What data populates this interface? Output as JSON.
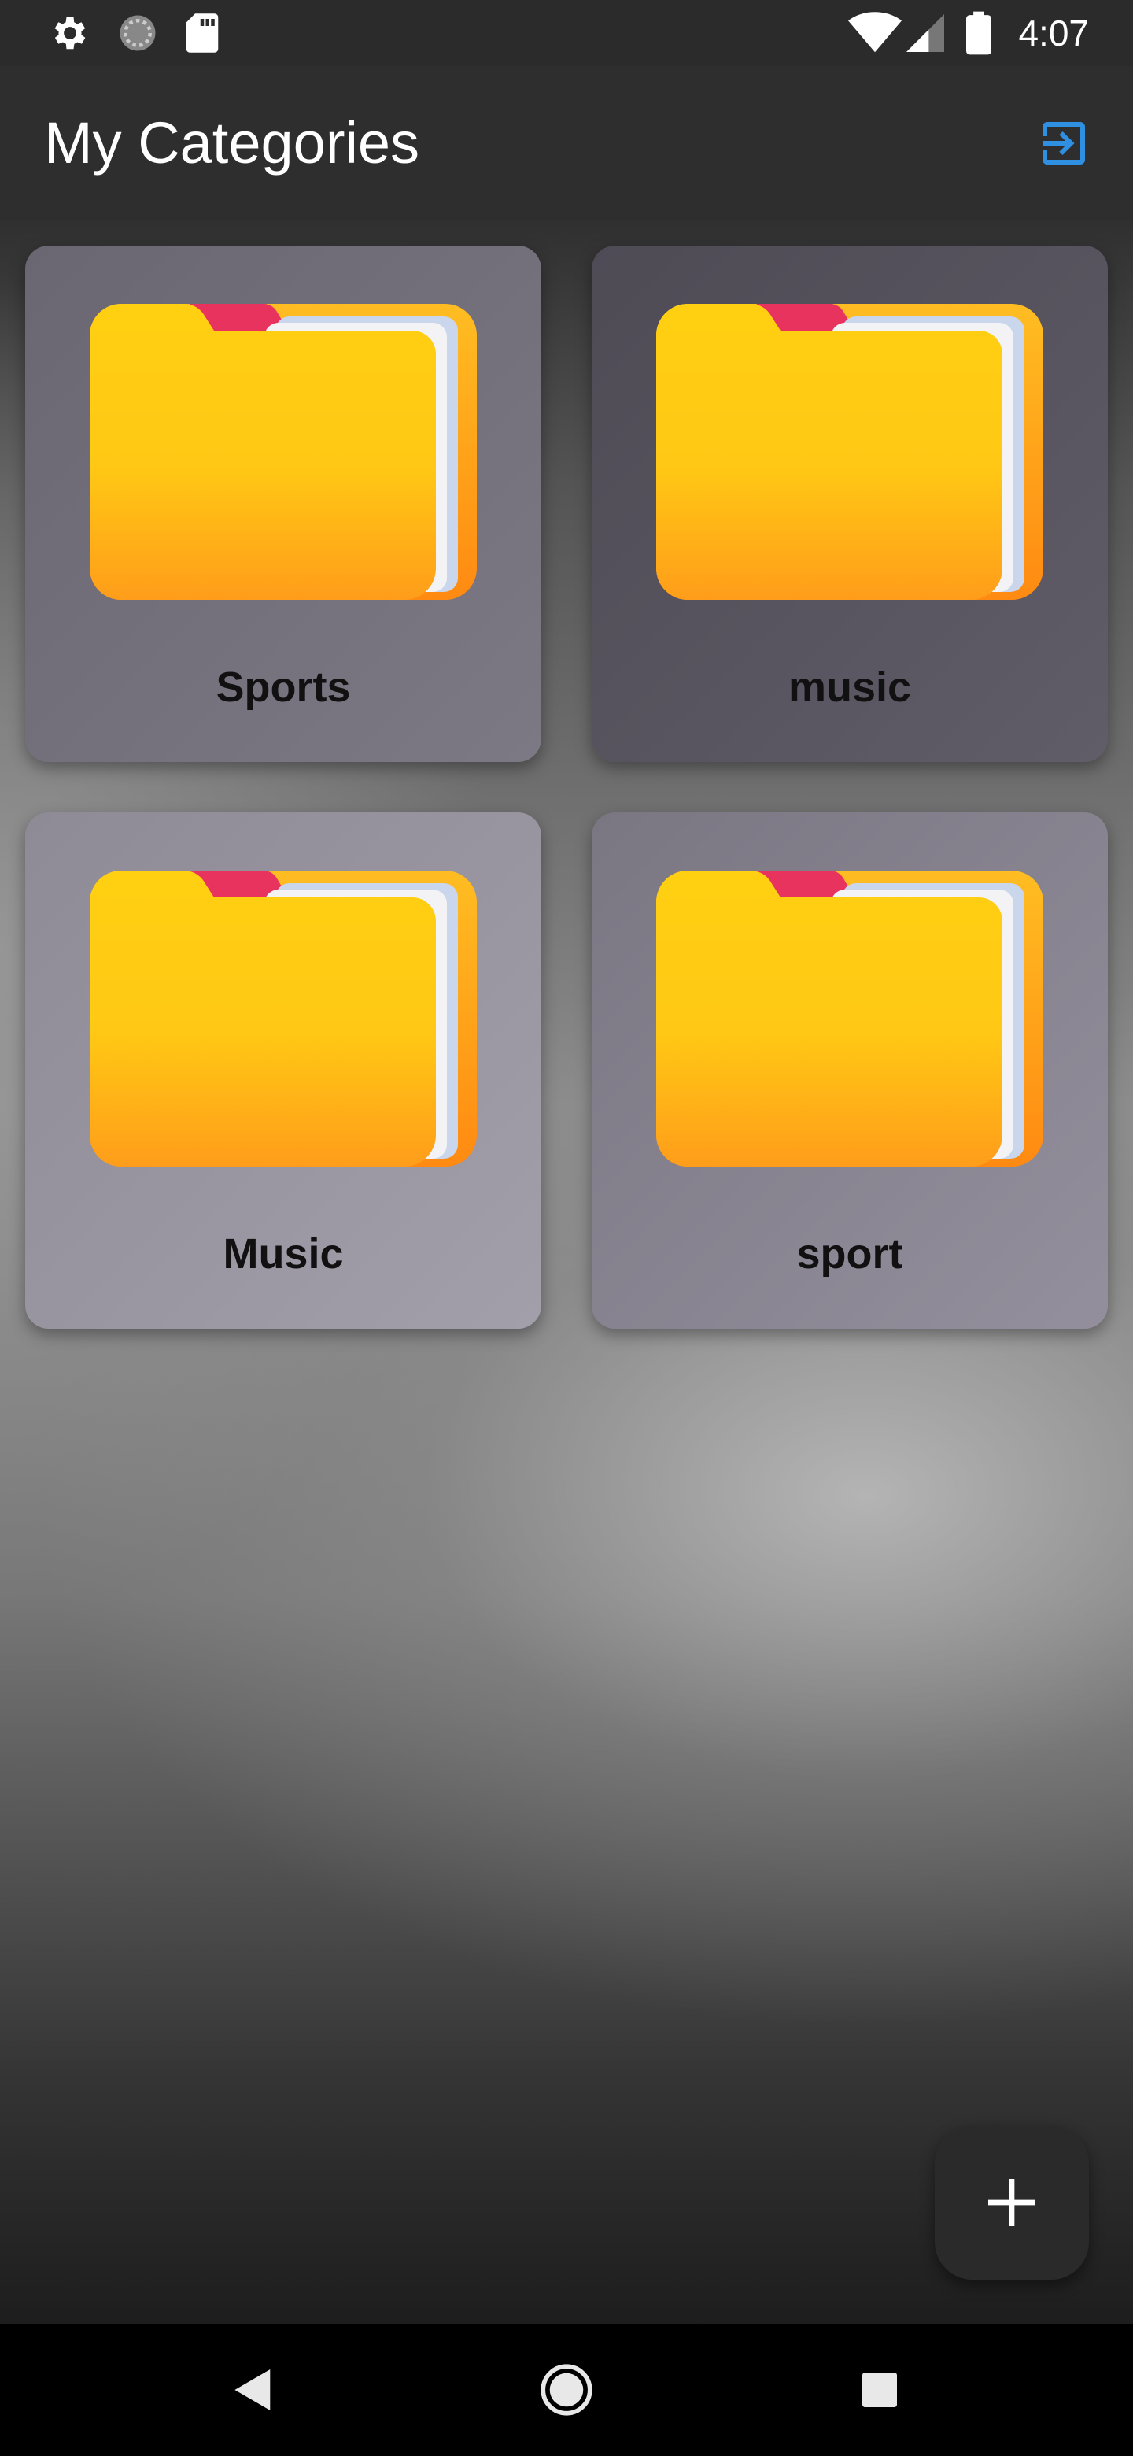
{
  "status_bar": {
    "time": "4:07",
    "left_icons": [
      "gear-icon",
      "sync-icon",
      "sd-card-icon"
    ],
    "right_icons": [
      "wifi-icon",
      "cell-signal-icon",
      "battery-icon"
    ]
  },
  "app_bar": {
    "title": "My Categories",
    "action_icon": "logout-icon",
    "action_color": "#2f8fe0"
  },
  "categories": [
    {
      "label": "Sports",
      "icon": "folder-icon"
    },
    {
      "label": "music",
      "icon": "folder-icon"
    },
    {
      "label": "Music",
      "icon": "folder-icon"
    },
    {
      "label": "sport",
      "icon": "folder-icon"
    }
  ],
  "fab": {
    "icon": "plus-icon"
  },
  "nav_bar": {
    "icons": [
      "back-icon",
      "home-icon",
      "recents-icon"
    ]
  }
}
